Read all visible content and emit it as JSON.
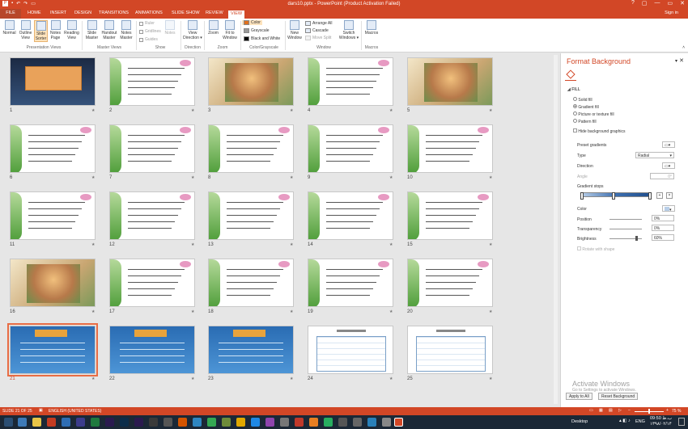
{
  "window": {
    "title": "dars10.pptx - PowerPoint (Product Activation Failed)",
    "controls": [
      "?",
      "▢",
      "—",
      "▭",
      "✕"
    ]
  },
  "quick_access": [
    "save-icon",
    "undo-icon",
    "redo-icon",
    "start-from-beginning-icon"
  ],
  "tabs": [
    "FILE",
    "HOME",
    "INSERT",
    "DESIGN",
    "TRANSITIONS",
    "ANIMATIONS",
    "SLIDE SHOW",
    "REVIEW",
    "VIEW"
  ],
  "active_tab": "VIEW",
  "sign_in": "Sign in",
  "ribbon": {
    "presentation_views": {
      "group": "Presentation Views",
      "buttons": [
        "Normal",
        "Outline View",
        "Slide Sorter",
        "Notes Page",
        "Reading View"
      ]
    },
    "master_views": {
      "group": "Master Views",
      "buttons": [
        "Slide Master",
        "Handout Master",
        "Notes Master"
      ]
    },
    "show": {
      "group": "Show",
      "items": [
        "Ruler",
        "Gridlines",
        "Guides"
      ],
      "notes": "Notes"
    },
    "direction": {
      "group": "Direction",
      "button": "View Direction ▾"
    },
    "zoom": {
      "group": "Zoom",
      "buttons": [
        "Zoom",
        "Fit to Window"
      ]
    },
    "color": {
      "group": "Color/Grayscale",
      "items": [
        "Color",
        "Grayscale",
        "Black and White"
      ]
    },
    "window": {
      "group": "Window",
      "new_window": "New Window",
      "items": [
        "Arrange All",
        "Cascade",
        "Move Split"
      ],
      "switch": "Switch Windows ▾"
    },
    "macros": {
      "group": "Macros",
      "button": "Macros"
    }
  },
  "slides": [
    {
      "n": "1",
      "theme": "dark"
    },
    {
      "n": "2",
      "theme": "frame"
    },
    {
      "n": "3",
      "theme": "photo"
    },
    {
      "n": "4",
      "theme": "frame"
    },
    {
      "n": "5",
      "theme": "photo"
    },
    {
      "n": "6",
      "theme": "frame"
    },
    {
      "n": "7",
      "theme": "frame"
    },
    {
      "n": "8",
      "theme": "frame"
    },
    {
      "n": "9",
      "theme": "frame"
    },
    {
      "n": "10",
      "theme": "frame"
    },
    {
      "n": "11",
      "theme": "frame"
    },
    {
      "n": "12",
      "theme": "frame"
    },
    {
      "n": "13",
      "theme": "frame"
    },
    {
      "n": "14",
      "theme": "frame"
    },
    {
      "n": "15",
      "theme": "frame"
    },
    {
      "n": "16",
      "theme": "photo"
    },
    {
      "n": "17",
      "theme": "frame"
    },
    {
      "n": "18",
      "theme": "frame"
    },
    {
      "n": "19",
      "theme": "frame"
    },
    {
      "n": "20",
      "theme": "frame"
    },
    {
      "n": "21",
      "theme": "blue"
    },
    {
      "n": "22",
      "theme": "blue"
    },
    {
      "n": "23",
      "theme": "blue"
    },
    {
      "n": "24",
      "theme": "grid"
    },
    {
      "n": "25",
      "theme": "grid"
    }
  ],
  "selected_slide": "21",
  "format_panel": {
    "title": "Format Background",
    "section": "FILL",
    "fill_options": [
      "Solid fill",
      "Gradient fill",
      "Picture or texture fill",
      "Pattern fill"
    ],
    "selected_fill": "Gradient fill",
    "hide_background": "Hide background graphics",
    "preset_label": "Preset gradients",
    "type_label": "Type",
    "type_value": "Radial",
    "direction_label": "Direction",
    "angle_label": "Angle",
    "angle_value": "0°",
    "gradient_stops": "Gradient stops",
    "color_label": "Color",
    "position_label": "Position",
    "position_value": "0%",
    "transparency_label": "Transparency",
    "transparency_value": "0%",
    "brightness_label": "Brightness",
    "brightness_value": "60%",
    "rotate": "Rotate with shape",
    "apply_all": "Apply to All",
    "reset": "Reset Background"
  },
  "watermark": {
    "line1": "Activate Windows",
    "line2": "Go to Settings to activate Windows."
  },
  "status_bar": {
    "slide": "SLIDE 21 OF 25",
    "language": "ENGLISH (UNITED STATES)",
    "zoom": "75 %"
  },
  "taskbar": {
    "desktop": "Desktop",
    "lang": "ENG",
    "time": "09:50 ب.ظ",
    "date": "۱۳۹۸/۰۲/۱۴"
  },
  "colors": {
    "accent": "#d24726",
    "ribbon_bg": "#ffffff",
    "workspace": "#e6e6e6",
    "taskbar": "#1b2836"
  }
}
